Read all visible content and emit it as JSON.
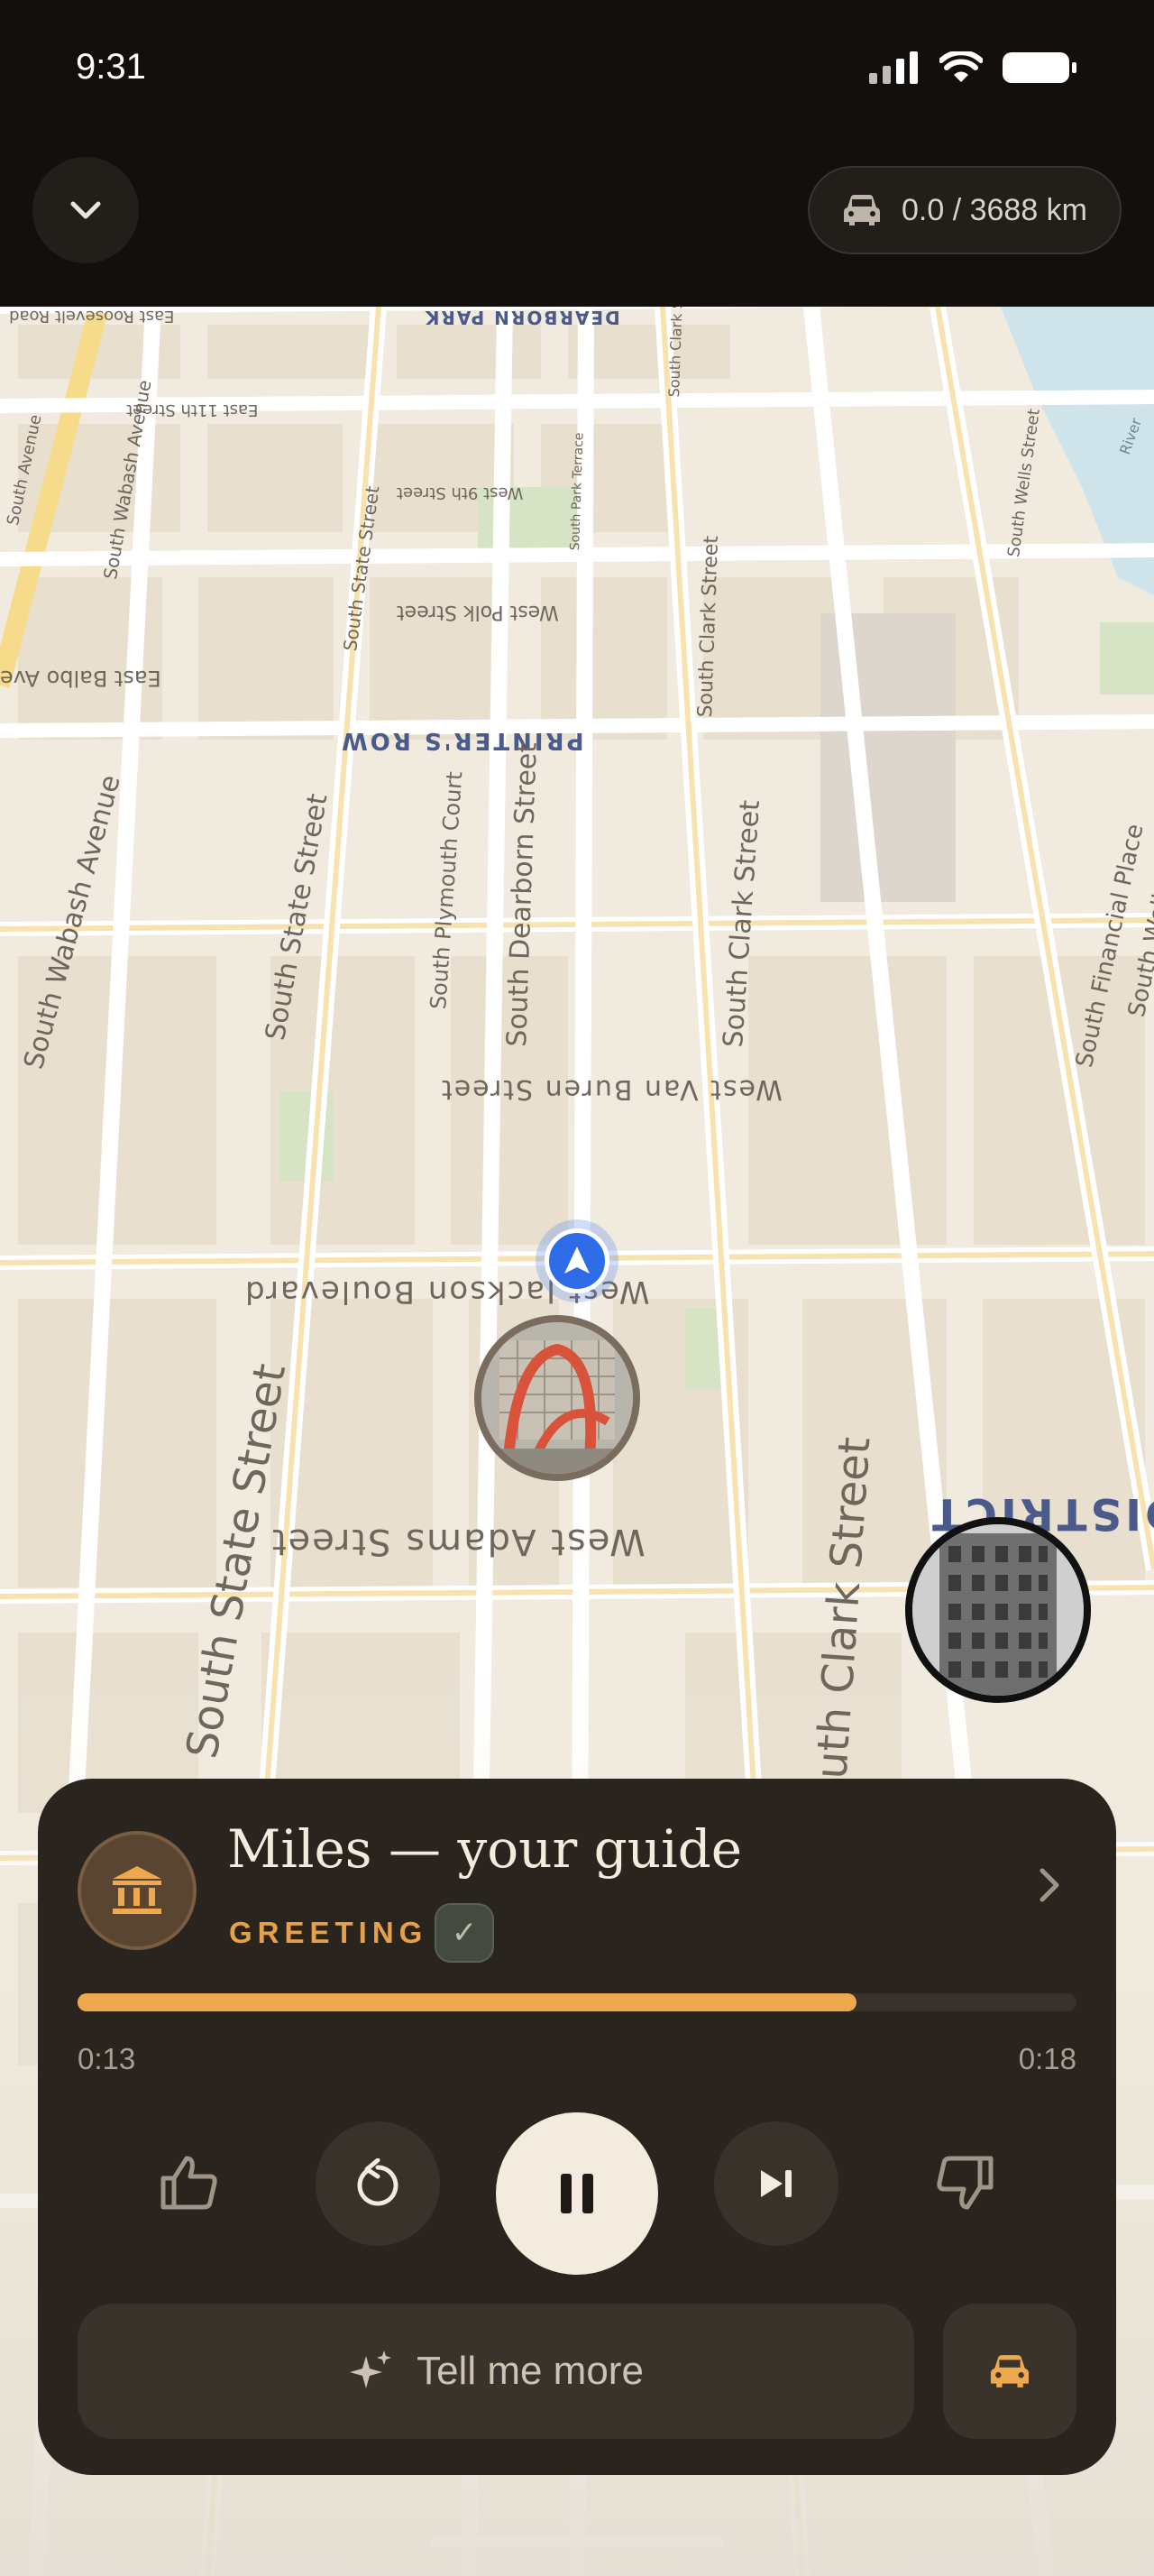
{
  "status_bar": {
    "time": "9:31"
  },
  "header": {
    "collapse_icon": "chevron-down-icon",
    "distance": "0.0 / 3688 km",
    "distance_icon": "car-icon"
  },
  "map": {
    "labels": {
      "roosevelt": "East Roosevelt Road",
      "dearborn_park": "DEARBORN PARK",
      "eleventh": "East 11th Street",
      "ninth": "West 9th Street",
      "polk": "West Polk Street",
      "balbo": "East Balbo Ave",
      "printers_row": "PRINTER'S ROW",
      "van_buren": "West Van Buren Street",
      "jackson": "West Jackson Boulevard",
      "adams": "West Adams Street",
      "south_state_1": "South State Street",
      "south_state_2": "South State Street",
      "south_state_3": "South State Street",
      "south_wabash_1": "South Wabash Avenue",
      "south_wabash_2": "South Wabash Avenue",
      "south_dearborn": "South Dearborn Street",
      "south_plymouth": "South Plymouth Court",
      "south_clark_1": "South Clark Street",
      "south_clark_2": "South Clark Street",
      "south_clark_3": "South Clark Street",
      "south_clark_4": "South Clark Street",
      "south_park_terrace": "South Park Terrace",
      "south_financial": "South Financial Place",
      "south_wells_1": "South Wells Street",
      "south_wells_2": "South Wells Street",
      "district": "DISTRICT",
      "south_avenue": "South Avenue",
      "river": "River"
    }
  },
  "player": {
    "icon": "museum-icon",
    "title": "Miles — your guide",
    "chapter": "GREETING",
    "check": "✓",
    "progress": 0.78,
    "time_current": "0:13",
    "time_total": "0:18",
    "tell_more": "Tell me more",
    "colors": {
      "accent": "#eea94e",
      "card": "#2a241e"
    }
  }
}
